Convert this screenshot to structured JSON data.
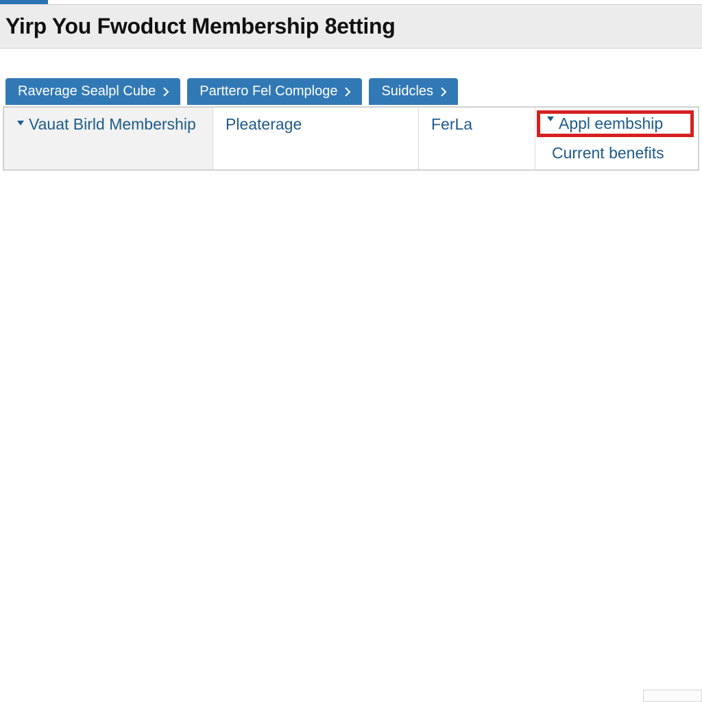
{
  "header": {
    "title": "Yirp You Fwoduct Membership 8etting"
  },
  "tabs": [
    {
      "label": "Raverage Sealpl Cube"
    },
    {
      "label": "Parttero Fel Comploge"
    },
    {
      "label": "Suidcles"
    }
  ],
  "panel": {
    "cells": [
      {
        "label": "Vauat Birld Membership",
        "hasCaret": true
      },
      {
        "label": "Pleaterage",
        "hasCaret": false
      },
      {
        "label": "FerLa",
        "hasCaret": false
      },
      {
        "label": "Appl eembship",
        "hasCaret": true,
        "highlighted": true
      }
    ],
    "sublink": "Current benefits"
  },
  "footer": {
    "label": ""
  },
  "colors": {
    "accent": "#3179b5",
    "link": "#1d5b8a",
    "highlight": "#d62020"
  }
}
